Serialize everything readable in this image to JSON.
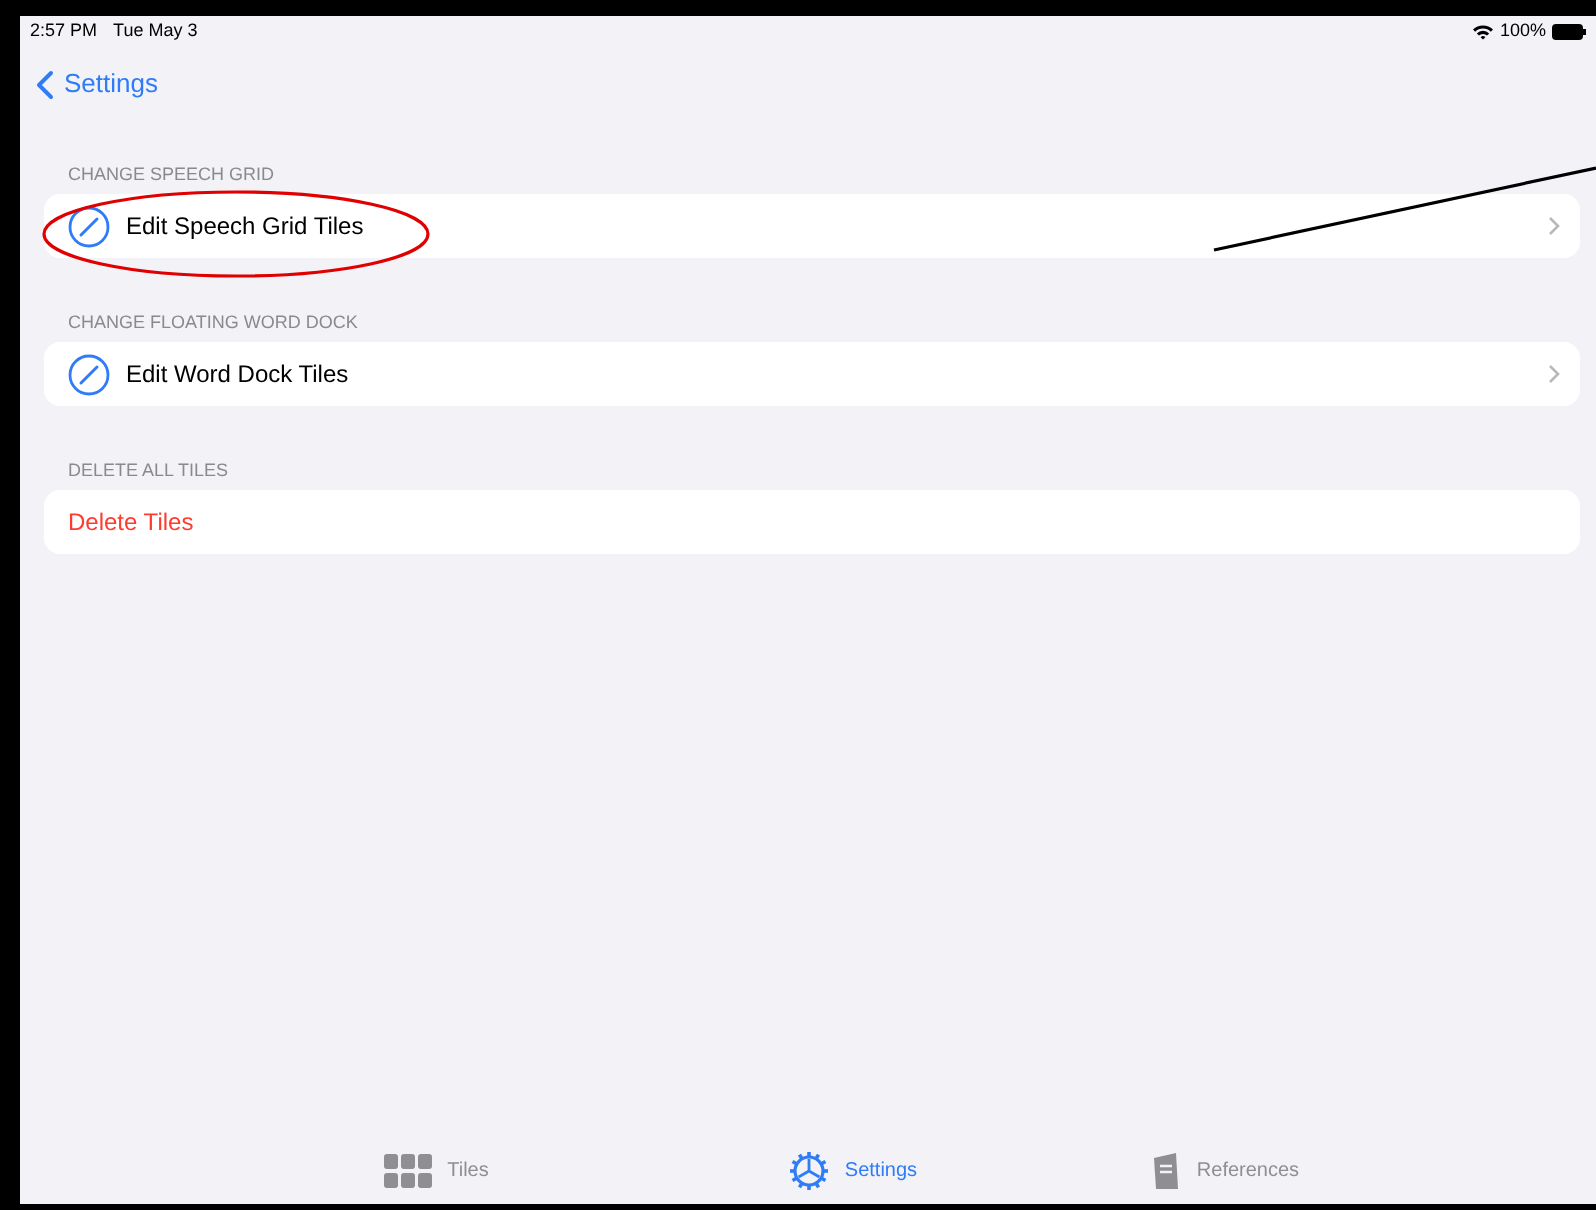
{
  "status_bar": {
    "time": "2:57 PM",
    "date": "Tue May 3",
    "battery": "100%"
  },
  "nav": {
    "back_label": "Settings"
  },
  "sections": [
    {
      "header": "CHANGE SPEECH GRID",
      "rows": [
        {
          "kind": "edit",
          "label": "Edit Speech Grid Tiles"
        }
      ]
    },
    {
      "header": "CHANGE FLOATING WORD DOCK",
      "rows": [
        {
          "kind": "edit",
          "label": "Edit Word Dock Tiles"
        }
      ]
    },
    {
      "header": "DELETE ALL TILES",
      "rows": [
        {
          "kind": "destructive",
          "label": "Delete Tiles"
        }
      ]
    }
  ],
  "tab_bar": [
    {
      "label": "Tiles",
      "selected": false
    },
    {
      "label": "Settings",
      "selected": true
    },
    {
      "label": "References",
      "selected": false
    }
  ]
}
